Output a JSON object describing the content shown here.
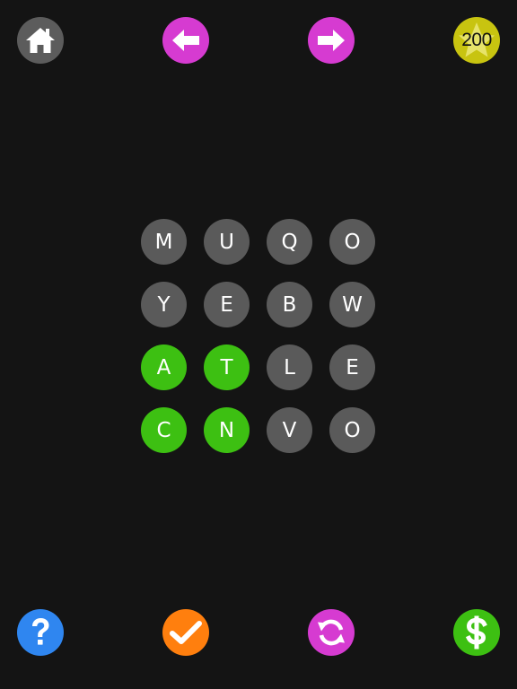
{
  "colors": {
    "background": "#141414",
    "home": "#5c5c5c",
    "nav_arrow": "#d63bd1",
    "score": "#c8c410",
    "score_star": "#e6e36a",
    "help": "#2f86f0",
    "check": "#ff7f0e",
    "shuffle": "#d63bd1",
    "shop": "#3dc012",
    "tile_default": "#5a5a5a",
    "tile_selected": "#3dc012"
  },
  "top_bar": {
    "home_icon": "home-icon",
    "back_icon": "arrow-left-icon",
    "forward_icon": "arrow-right-icon",
    "score_icon": "star-icon",
    "score": "200"
  },
  "board": {
    "rows": [
      [
        {
          "letter": "M",
          "selected": false
        },
        {
          "letter": "U",
          "selected": false
        },
        {
          "letter": "Q",
          "selected": false
        },
        {
          "letter": "O",
          "selected": false
        }
      ],
      [
        {
          "letter": "Y",
          "selected": false
        },
        {
          "letter": "E",
          "selected": false
        },
        {
          "letter": "B",
          "selected": false
        },
        {
          "letter": "W",
          "selected": false
        }
      ],
      [
        {
          "letter": "A",
          "selected": true
        },
        {
          "letter": "T",
          "selected": true
        },
        {
          "letter": "L",
          "selected": false
        },
        {
          "letter": "E",
          "selected": false
        }
      ],
      [
        {
          "letter": "C",
          "selected": true
        },
        {
          "letter": "N",
          "selected": true
        },
        {
          "letter": "V",
          "selected": false
        },
        {
          "letter": "O",
          "selected": false
        }
      ]
    ]
  },
  "bottom_bar": {
    "help_icon": "question-icon",
    "check_icon": "checkmark-icon",
    "shuffle_icon": "shuffle-icon",
    "shop_icon": "dollar-icon"
  }
}
